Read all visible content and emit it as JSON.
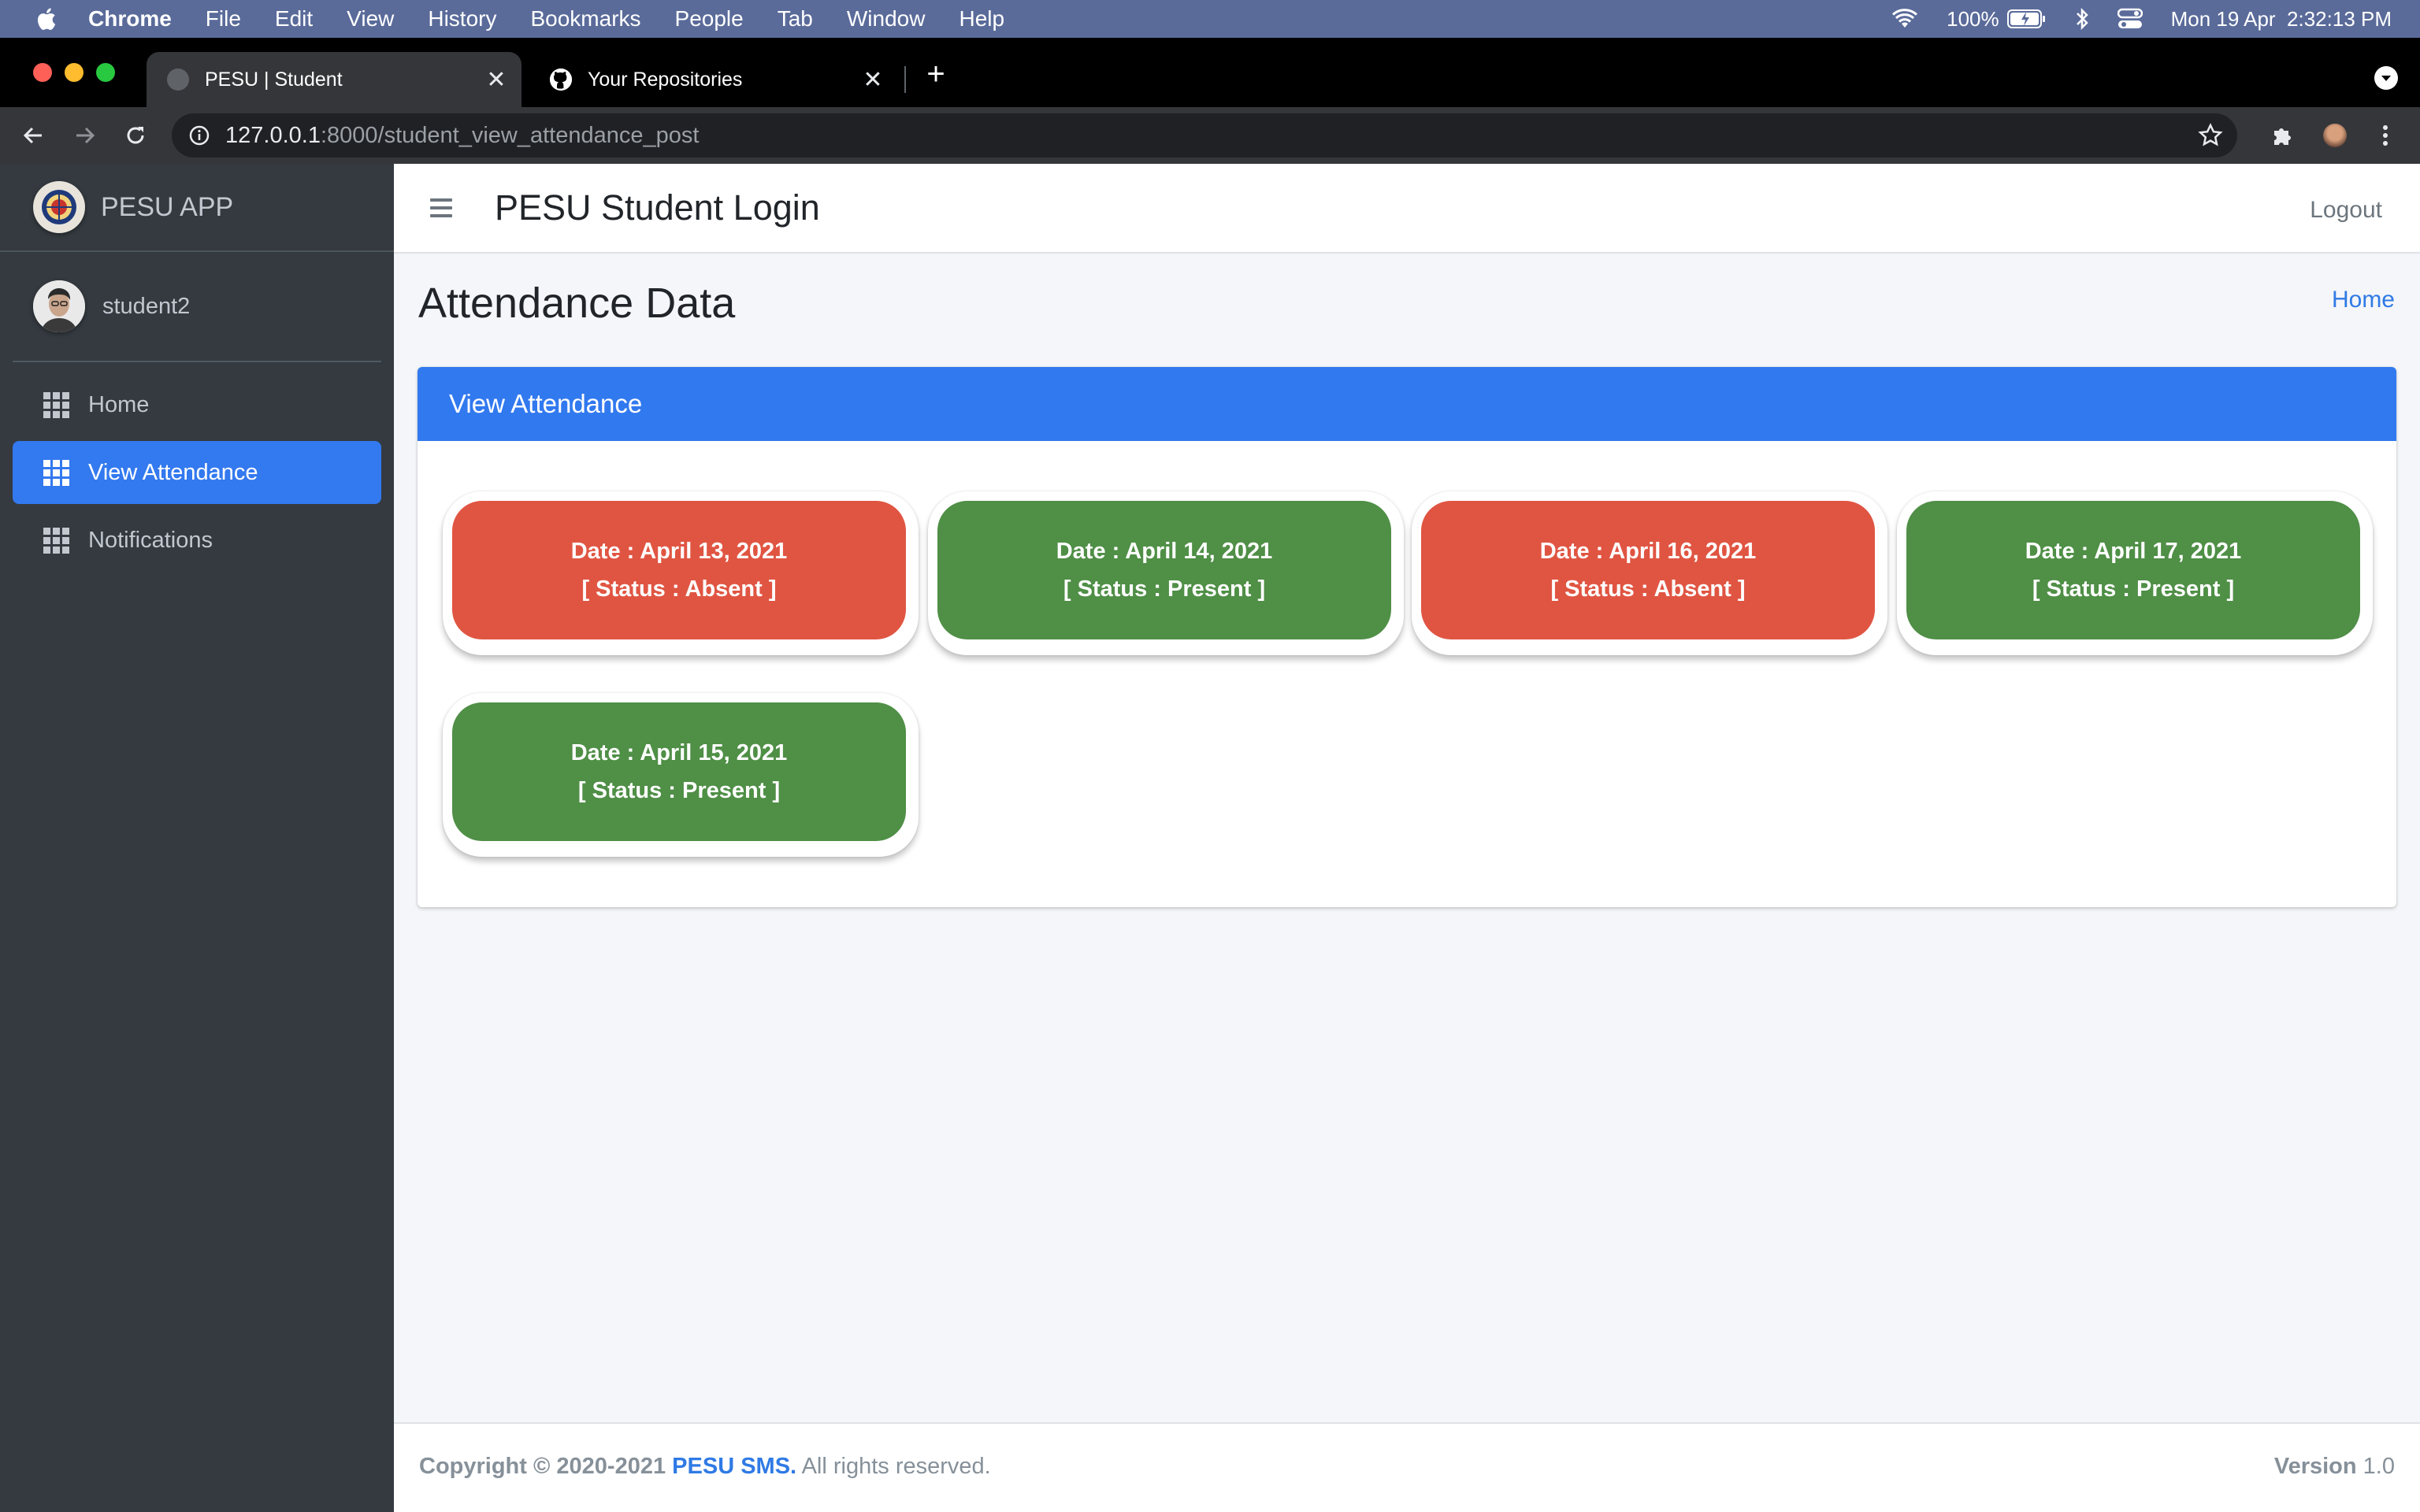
{
  "menubar": {
    "app": "Chrome",
    "items": [
      "File",
      "Edit",
      "View",
      "History",
      "Bookmarks",
      "People",
      "Tab",
      "Window",
      "Help"
    ],
    "battery": "100%",
    "clock": "Mon 19 Apr  2:32:13 PM"
  },
  "browser": {
    "tabs": [
      {
        "title": "PESU | Student",
        "active": true
      },
      {
        "title": "Your Repositories",
        "active": false
      }
    ],
    "url_host": "127.0.0.1",
    "url_rest": ":8000/student_view_attendance_post"
  },
  "sidebar": {
    "brand": "PESU APP",
    "username": "student2",
    "items": [
      {
        "label": "Home",
        "icon": "grid-icon",
        "active": false
      },
      {
        "label": "View Attendance",
        "icon": "grid-icon",
        "active": true
      },
      {
        "label": "Notifications",
        "icon": "grid-icon",
        "active": false
      }
    ]
  },
  "header": {
    "title": "PESU Student Login",
    "logout": "Logout"
  },
  "content": {
    "title": "Attendance Data",
    "breadcrumb": "Home",
    "card_title": "View Attendance",
    "records": [
      {
        "date": "Date : April 13, 2021",
        "status": "[ Status : Absent ]",
        "state": "absent"
      },
      {
        "date": "Date : April 14, 2021",
        "status": "[ Status : Present ]",
        "state": "present"
      },
      {
        "date": "Date : April 16, 2021",
        "status": "[ Status : Absent ]",
        "state": "absent"
      },
      {
        "date": "Date : April 17, 2021",
        "status": "[ Status : Present ]",
        "state": "present"
      },
      {
        "date": "Date : April 15, 2021",
        "status": "[ Status : Present ]",
        "state": "present"
      }
    ]
  },
  "footer": {
    "copyright_prefix": "Copyright © 2020-2021",
    "brand_link": "PESU SMS.",
    "rights": "All rights reserved.",
    "version_label": "Version",
    "version_value": "1.0"
  },
  "colors": {
    "accent": "#3379ef",
    "absent": "#e05542",
    "present": "#4f8f46",
    "sidebar": "#343a40"
  }
}
